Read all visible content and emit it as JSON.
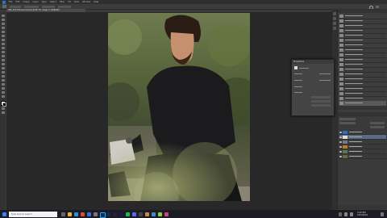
{
  "app": {
    "menus": [
      "File",
      "Edit",
      "Image",
      "Layer",
      "Type",
      "Select",
      "Filter",
      "3D",
      "View",
      "Window",
      "Help"
    ],
    "document_tab": "IMG_8714-Enhanced.psd @ 66.7% (Layer 1, RGB/8#)"
  },
  "properties_panel": {
    "title": "Properties"
  },
  "taskbar": {
    "search_placeholder": "Type here to search",
    "time": "3:42 PM",
    "date": "5/24/2021"
  },
  "colors": {
    "accent": "#2d6fc2",
    "canvas_bg": "#282828",
    "panel_bg": "#3d3d3d"
  }
}
